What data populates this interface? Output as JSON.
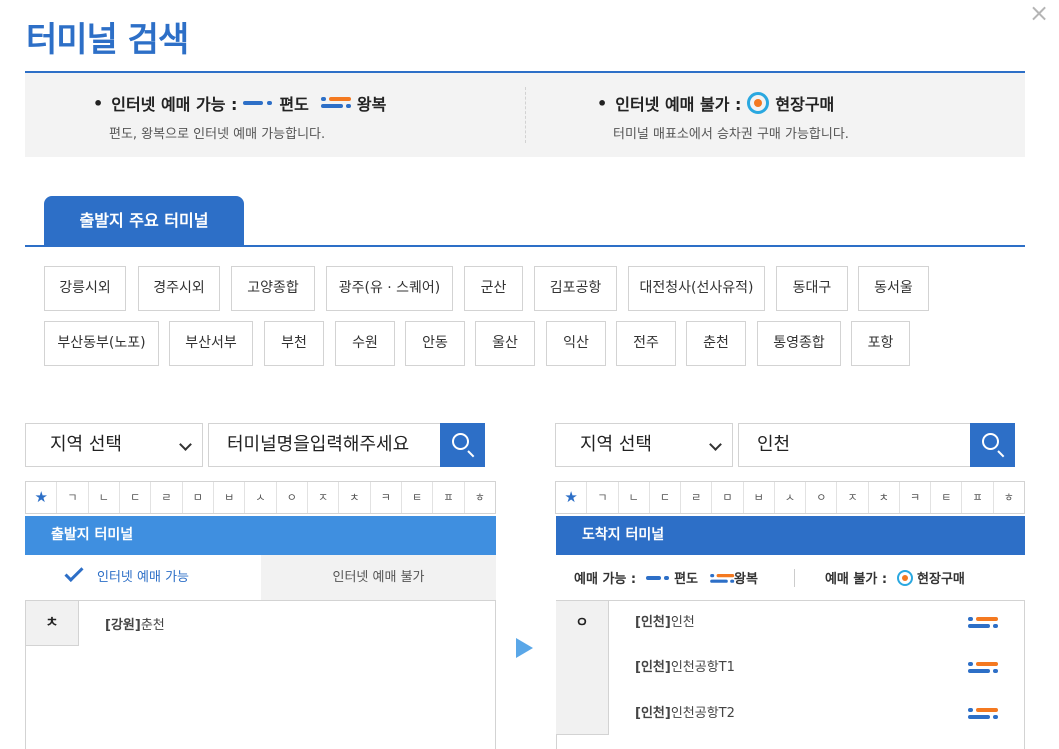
{
  "page": {
    "title": "터미널 검색",
    "close_label": "×"
  },
  "info": {
    "left": {
      "bullet": "•",
      "heading": "인터넷 예매 가능 :",
      "oneway": "편도",
      "round": "왕복",
      "desc": "편도, 왕복으로 인터넷 예매 가능합니다."
    },
    "right": {
      "bullet": "•",
      "heading": "인터넷 예매 불가 :",
      "onsite": "현장구매",
      "desc": "터미널 매표소에서 승차권 구매 가능합니다."
    }
  },
  "main_tab": "출발지 주요 터미널",
  "terminals_row1": [
    "강릉시외",
    "경주시외",
    "고양종합",
    "광주(유 · 스퀘어)",
    "군산",
    "김포공항",
    "대전청사(선사유적)",
    "동대구",
    "동서울"
  ],
  "terminals_row2": [
    "부산동부(노포)",
    "부산서부",
    "부천",
    "수원",
    "안동",
    "울산",
    "익산",
    "전주",
    "춘천",
    "통영종합",
    "포항"
  ],
  "consonants": [
    "★",
    "ㄱ",
    "ㄴ",
    "ㄷ",
    "ㄹ",
    "ㅁ",
    "ㅂ",
    "ㅅ",
    "ㅇ",
    "ㅈ",
    "ㅊ",
    "ㅋ",
    "ㅌ",
    "ㅍ",
    "ㅎ"
  ],
  "departure": {
    "region_select": "지역 선택",
    "search_placeholder": "터미널명을입력해주세요",
    "search_value": "",
    "panel_title": "출발지 터미널",
    "tab_available": "인터넷 예매 가능",
    "tab_unavailable": "인터넷 예매 불가",
    "index": "ㅊ",
    "items": [
      {
        "region": "[강원]",
        "name": "춘천"
      }
    ]
  },
  "arrival": {
    "region_select": "지역 선택",
    "search_value": "인천",
    "panel_title": "도착지 터미널",
    "legend": {
      "available": "예매 가능 :",
      "oneway": "편도",
      "round": "왕복",
      "unavailable": "예매 불가 :",
      "onsite": "현장구매"
    },
    "index": "ㅇ",
    "items": [
      {
        "region": "[인천]",
        "name": "인천"
      },
      {
        "region": "[인천]",
        "name": "인천공항T1"
      },
      {
        "region": "[인천]",
        "name": "인천공항T2"
      }
    ]
  },
  "colors": {
    "primary": "#2d6fc7",
    "light_primary": "#3f8fe0",
    "orange": "#f47920"
  }
}
